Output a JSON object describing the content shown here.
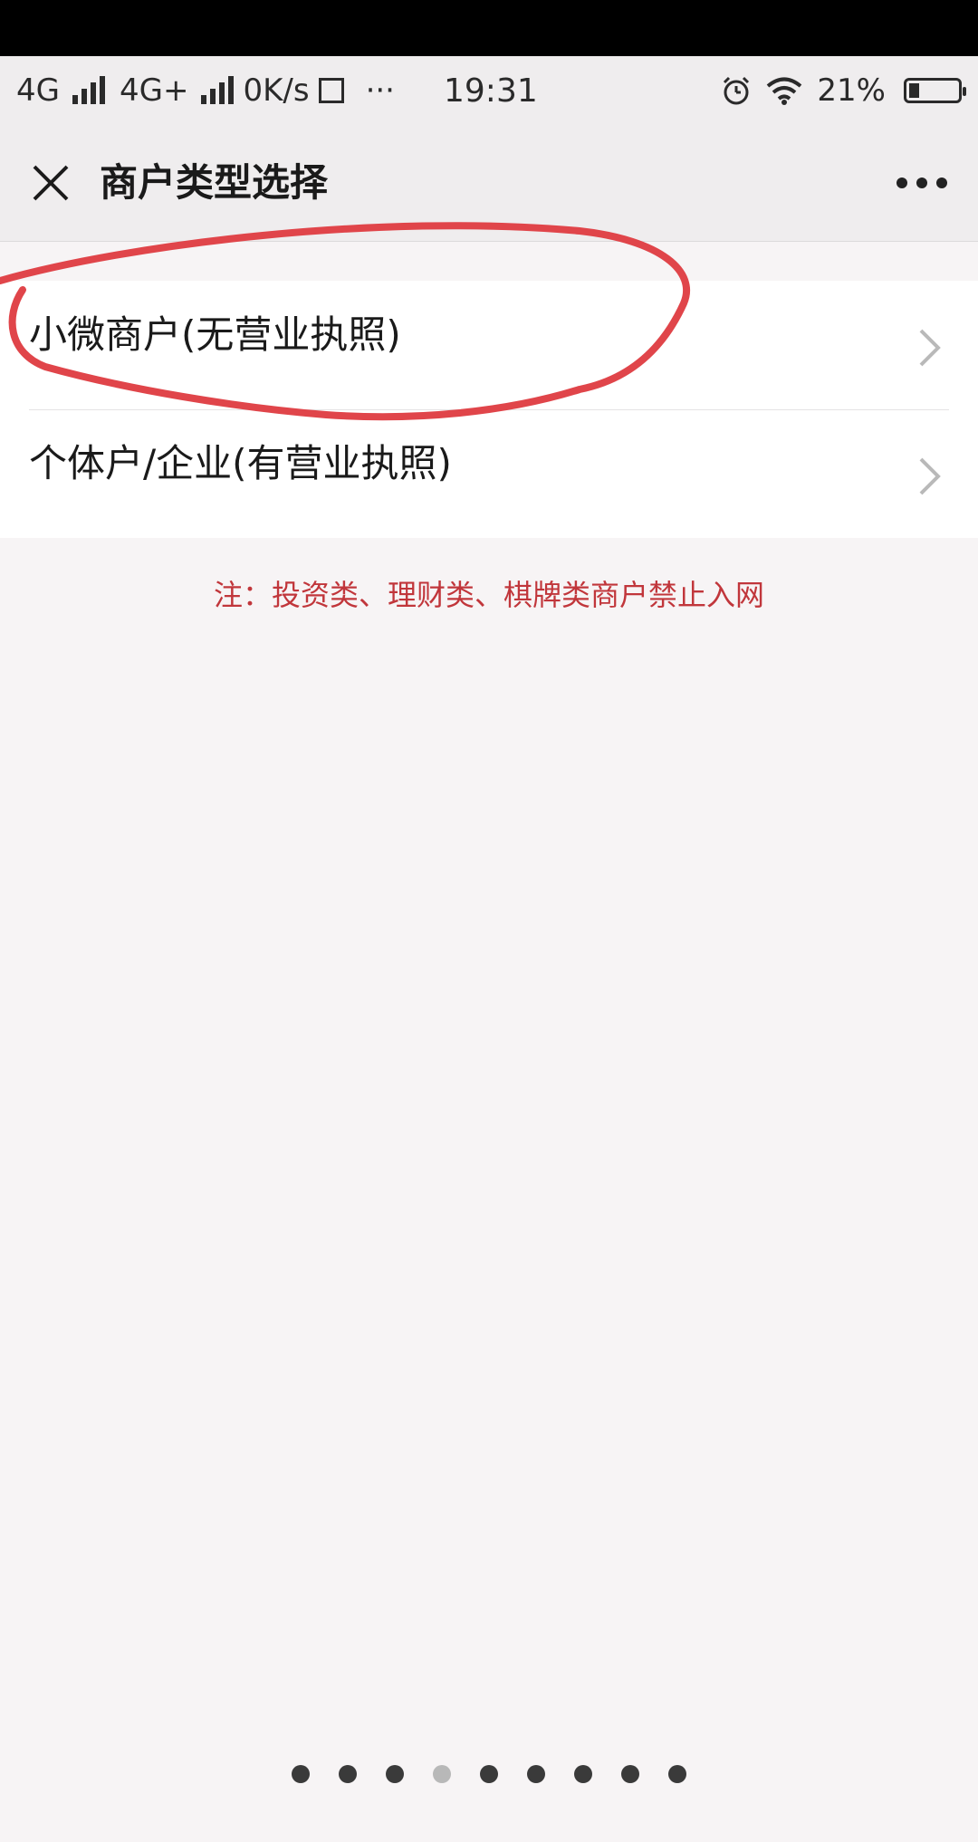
{
  "status_bar": {
    "network1": "4G",
    "network2": "4G+",
    "speed": "0K/s",
    "more": "···",
    "time": "19:31",
    "battery_percent": "21%",
    "battery_level": 0.21,
    "icons": [
      "signal-icon",
      "screen-icon",
      "alarm-icon",
      "wifi-icon",
      "battery-icon"
    ]
  },
  "nav": {
    "title": "商户类型选择",
    "close_icon": "close-icon",
    "more_icon": "more-icon"
  },
  "options": [
    {
      "label": "小微商户(无营业执照)",
      "icon": "chevron-right-icon"
    },
    {
      "label": "个体户/企业(有营业执照)",
      "icon": "chevron-right-icon"
    }
  ],
  "notice": "注：投资类、理财类、棋牌类商户禁止入网",
  "annotation": {
    "color": "#e0454a"
  },
  "pagination": {
    "total": 9,
    "active_index": 3
  },
  "colors": {
    "notice_text": "#c1363b",
    "background": "#f7f4f5",
    "bar_background": "#efedee"
  }
}
